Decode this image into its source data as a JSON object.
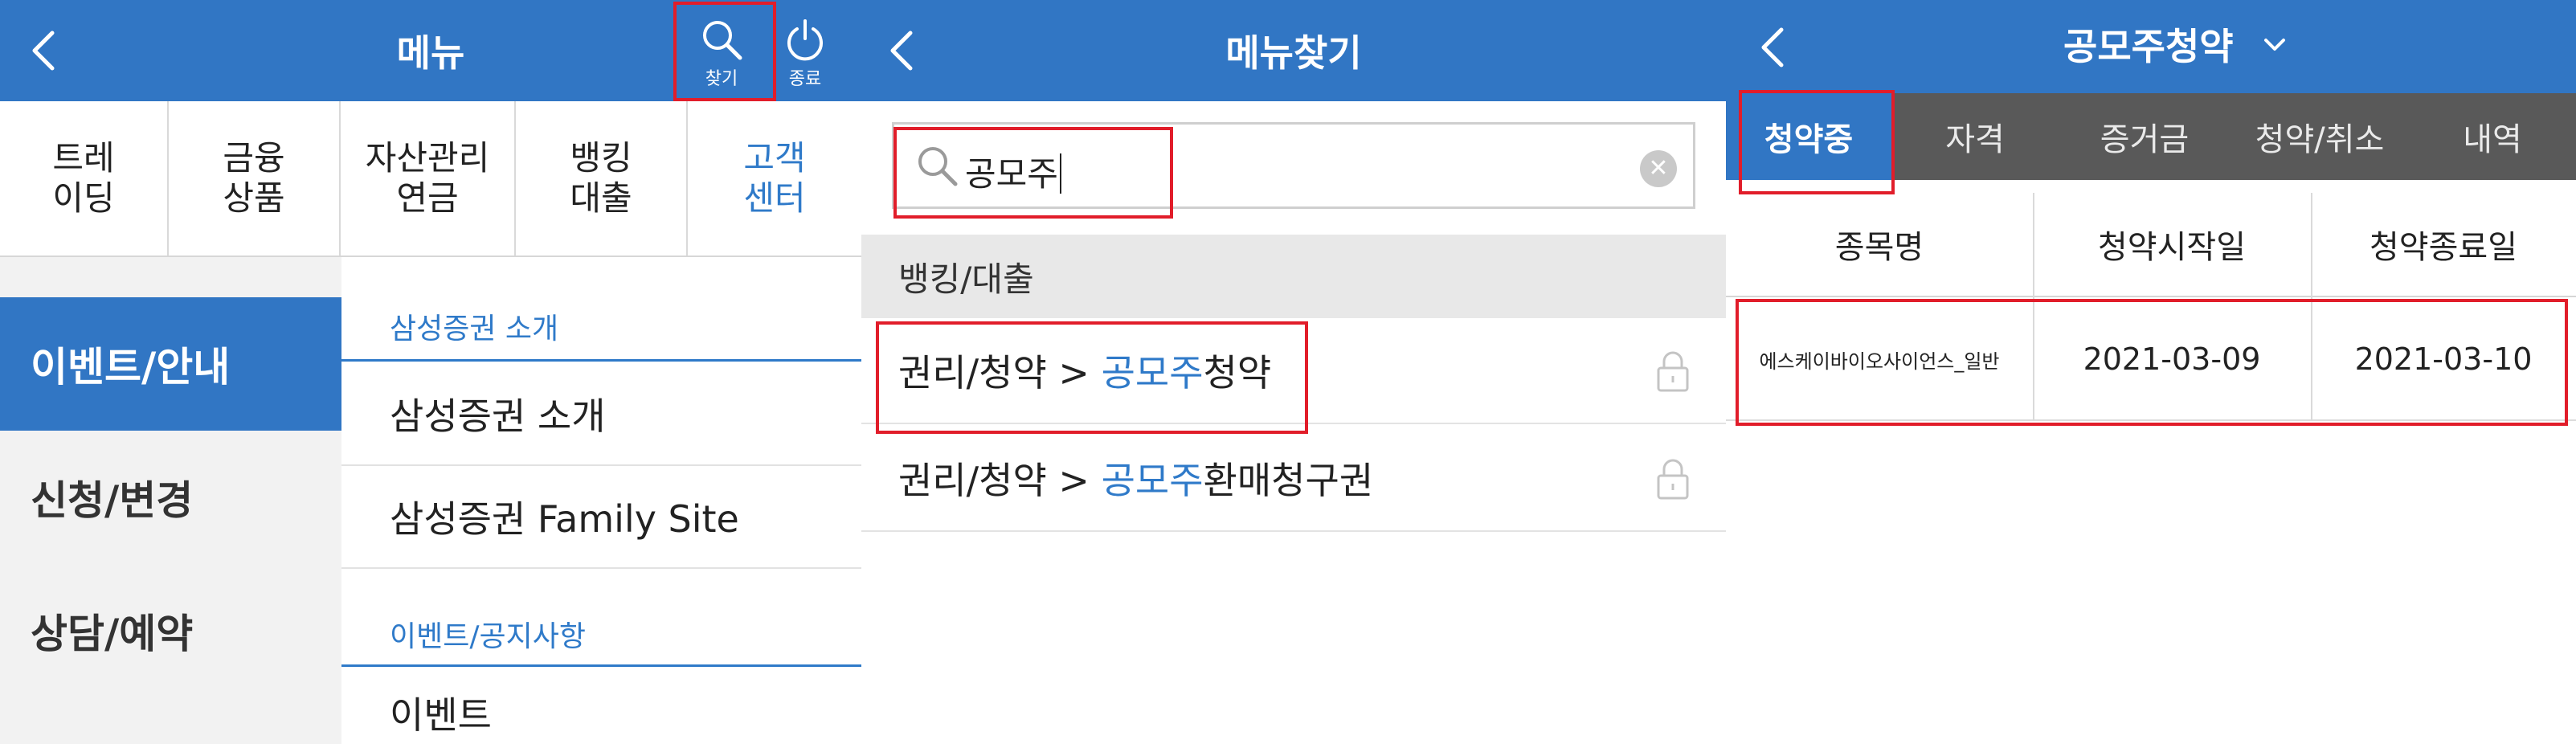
{
  "panel1": {
    "title": "메뉴",
    "search_btn_label": "찾기",
    "exit_btn_label": "종료",
    "category_tabs": [
      "트레\n이딩",
      "금융\n상품",
      "자산관리\n연금",
      "뱅킹\n대출",
      "고객\n센터"
    ],
    "left_nav": [
      "이벤트/안내",
      "신청/변경",
      "상담/예약"
    ],
    "submenu": {
      "section1": "삼성증권 소개",
      "items1": [
        "삼성증권 소개",
        "삼성증권 Family Site"
      ],
      "section2": "이벤트/공지사항",
      "items2": [
        "이벤트"
      ]
    }
  },
  "panel2": {
    "title": "메뉴찾기",
    "search_value": "공모주",
    "section": "뱅킹/대출",
    "results": [
      {
        "prefix": "권리/청약 > ",
        "highlight": "공모주",
        "suffix": "청약"
      },
      {
        "prefix": "권리/청약 > ",
        "highlight": "공모주",
        "suffix": "환매청구권"
      }
    ]
  },
  "panel3": {
    "title": "공모주청약",
    "tabs": [
      "청약중",
      "자격",
      "증거금",
      "청약/취소",
      "내역"
    ],
    "columns": [
      "종목명",
      "청약시작일",
      "청약종료일"
    ],
    "rows": [
      {
        "name": "에스케이바이오사이언스_일반",
        "start": "2021-03-09",
        "end": "2021-03-10"
      }
    ]
  },
  "colors": {
    "header_blue": "#3176c4",
    "highlight_blue": "#2f7ac9",
    "annotation_red": "#e11d2a",
    "tab_bar_gray": "#595959"
  },
  "icons": [
    "chevron-left-icon",
    "search-icon",
    "power-icon",
    "clear-icon",
    "lock-icon",
    "chevron-down-icon"
  ]
}
